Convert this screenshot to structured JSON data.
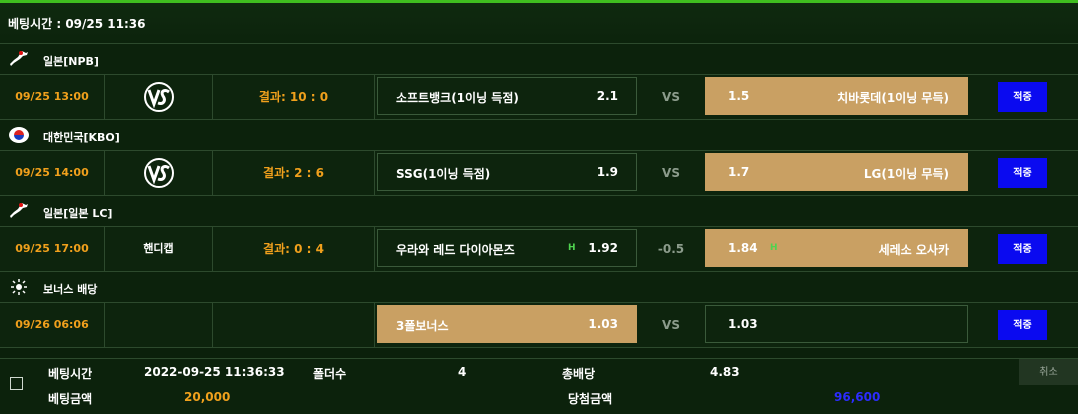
{
  "header": {
    "bet_time_label": "베팅시간 : 09/25 11:36"
  },
  "leagues": [
    {
      "name": "일본[NPB]",
      "flag": "japan-flag-icon"
    },
    {
      "name": "대한민국[KBO]",
      "flag": "korea-flag-icon"
    },
    {
      "name": "일본[일본 LC]",
      "flag": "japan-flag-icon"
    },
    {
      "name": "보너스 배당",
      "flag": "bonus-icon"
    }
  ],
  "games": [
    {
      "time": "09/25 13:00",
      "type_icon": "vs-icon",
      "result": "결과: 10 : 0",
      "home": "소프트뱅크(1이닝 득점)",
      "home_odd": "2.1",
      "draw": "VS",
      "away_odd": "1.5",
      "away": "치바롯데(1이닝 무득)",
      "status": "적중"
    },
    {
      "time": "09/25 14:00",
      "type_icon": "vs-icon",
      "result": "결과: 2 : 6",
      "home": "SSG(1이닝 득점)",
      "home_odd": "1.9",
      "draw": "VS",
      "away_odd": "1.7",
      "away": "LG(1이닝 무득)",
      "status": "적중"
    },
    {
      "time": "09/25 17:00",
      "type_text": "핸디캡",
      "result": "결과: 0 : 4",
      "home": "우라와 레드 다이아몬즈",
      "home_tag": "H",
      "home_odd": "1.92",
      "draw": "-0.5",
      "away_odd": "1.84",
      "away_tag": "H",
      "away": "세레소 오사카",
      "status": "적중"
    },
    {
      "time": "09/26 06:06",
      "home": "3폴보너스",
      "home_odd": "1.03",
      "draw": "VS",
      "away_odd": "1.03",
      "status": "적중"
    }
  ],
  "summary": {
    "bet_time_label": "베팅시간",
    "bet_time_value": "2022-09-25 11:36:33",
    "folder_label": "폴더수",
    "folder_value": "4",
    "total_odds_label": "총배당",
    "total_odds_value": "4.83",
    "bet_amount_label": "베팅금액",
    "bet_amount_value": "20,000",
    "win_amount_label": "당첨금액",
    "win_amount_value": "96,600",
    "cancel_label": "취소"
  },
  "colors": {
    "accent": "#f0a01c",
    "selected": "#c9a063",
    "button": "#0a0af0",
    "win_amount": "#2c2cff"
  }
}
